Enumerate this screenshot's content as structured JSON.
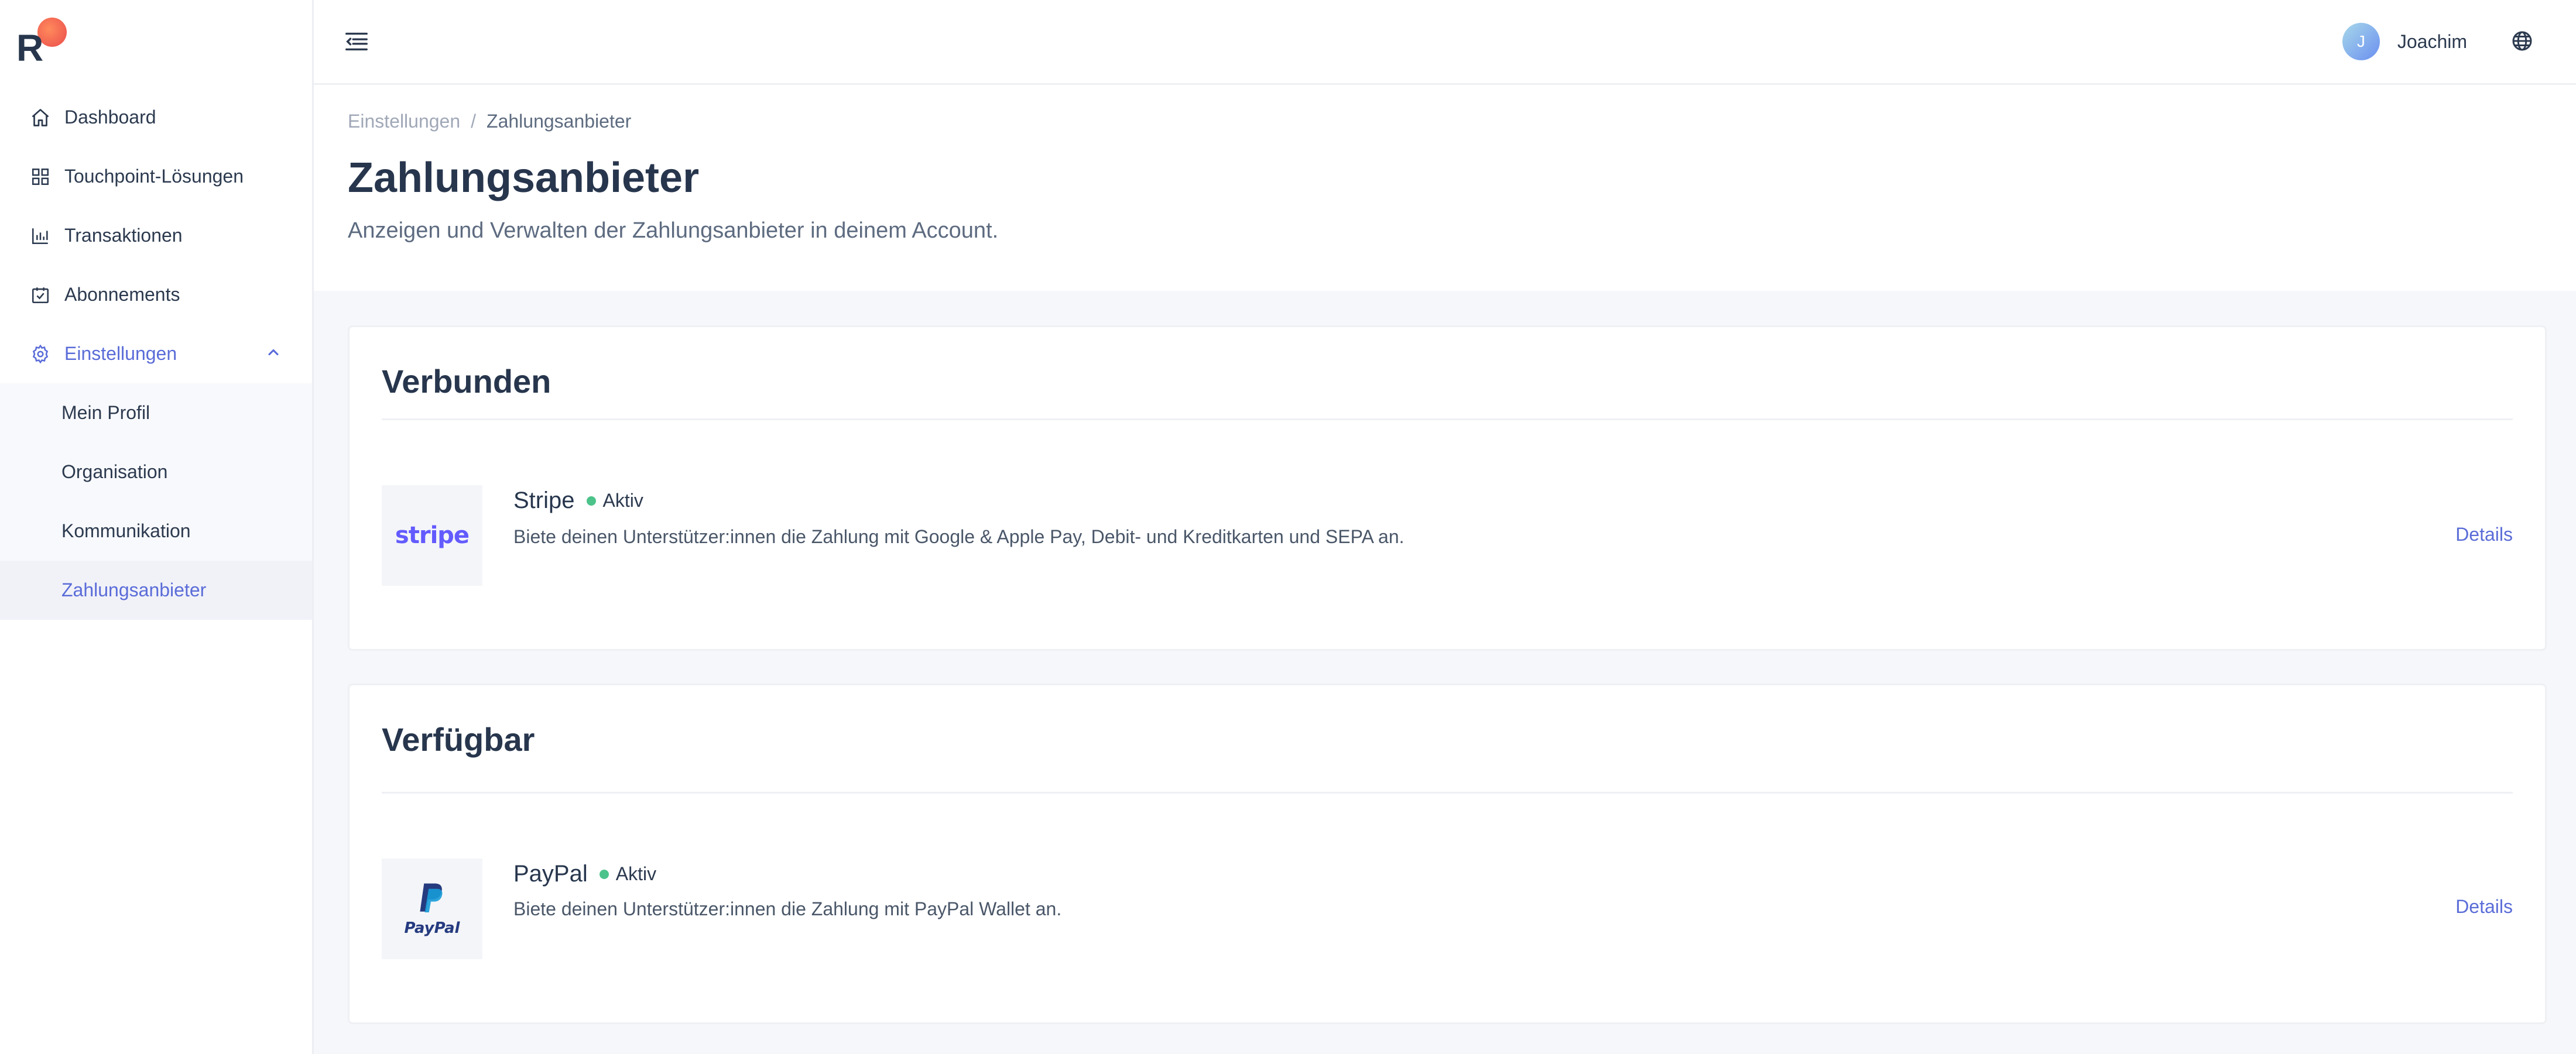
{
  "sidebar": {
    "logo_letter": "R",
    "items": [
      {
        "label": "Dashboard",
        "icon": "home-icon"
      },
      {
        "label": "Touchpoint-Lösungen",
        "icon": "grid-icon"
      },
      {
        "label": "Transaktionen",
        "icon": "bar-chart-icon"
      },
      {
        "label": "Abonnements",
        "icon": "calendar-check-icon"
      },
      {
        "label": "Einstellungen",
        "icon": "gear-icon",
        "expanded": true
      }
    ],
    "subitems": [
      {
        "label": "Mein Profil"
      },
      {
        "label": "Organisation"
      },
      {
        "label": "Kommunikation"
      },
      {
        "label": "Zahlungsanbieter",
        "active": true
      }
    ]
  },
  "topbar": {
    "avatar_initial": "J",
    "user_name": "Joachim"
  },
  "header": {
    "breadcrumb": {
      "parent": "Einstellungen",
      "separator": "/",
      "current": "Zahlungsanbieter"
    },
    "title": "Zahlungsanbieter",
    "subtitle": "Anzeigen und Verwalten der Zahlungsanbieter in deinem Account."
  },
  "sections": [
    {
      "title": "Verbunden",
      "provider": {
        "name": "Stripe",
        "logo_text": "stripe",
        "status": "Aktiv",
        "description": "Biete deinen Unterstützer:innen die Zahlung mit Google & Apple Pay, Debit- und Kreditkarten und SEPA an.",
        "action": "Details"
      }
    },
    {
      "title": "Verfügbar",
      "provider": {
        "name": "PayPal",
        "logo_text": "PayPal",
        "status": "Aktiv",
        "description": "Biete deinen Unterstützer:innen die Zahlung mit PayPal Wallet an.",
        "action": "Details"
      }
    }
  ],
  "colors": {
    "accent": "#5a6cd8",
    "text_dark": "#27364d",
    "status_green": "#4cc38a",
    "stripe_brand": "#635bff",
    "paypal_dark": "#253b80",
    "paypal_light": "#179bd7"
  }
}
